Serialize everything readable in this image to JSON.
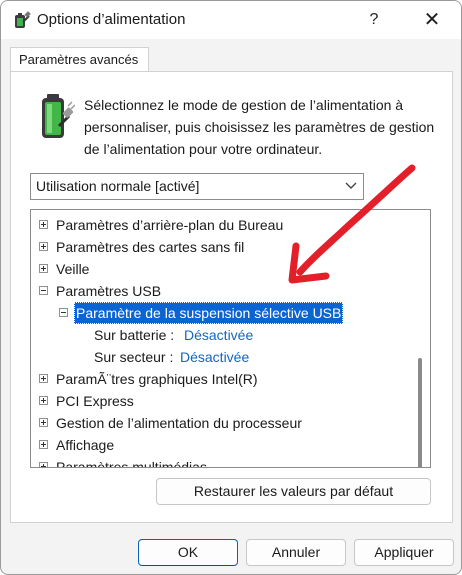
{
  "window": {
    "title": "Options d’alimentation",
    "help": "?",
    "close": "✕"
  },
  "tab": {
    "label": "Paramètres avancés"
  },
  "description": "Sélectionnez le mode de gestion de l’alimentation à personnaliser, puis choisissez les paramètres de gestion de l’alimentation pour votre ordinateur.",
  "plan_select": {
    "value": "Utilisation normale [activé]"
  },
  "tree": {
    "items": [
      {
        "label": "Paramètres d’arrière-plan du Bureau"
      },
      {
        "label": "Paramètres des cartes sans fil"
      },
      {
        "label": "Veille"
      },
      {
        "label": "Paramètres USB"
      },
      {
        "label": "Paramètre de la suspension sélective USB"
      },
      {
        "label": "Sur batterie :",
        "value": "Désactivée"
      },
      {
        "label": "Sur secteur :",
        "value": "Désactivée"
      },
      {
        "label": "ParamÃ¨tres graphiques Intel(R)"
      },
      {
        "label": "PCI Express"
      },
      {
        "label": "Gestion de l’alimentation du processeur"
      },
      {
        "label": "Affichage"
      },
      {
        "label": "Paramètres multimédias"
      }
    ]
  },
  "buttons": {
    "restore": "Restaurer les valeurs par défaut",
    "ok": "OK",
    "cancel": "Annuler",
    "apply": "Appliquer"
  },
  "colors": {
    "selection": "#0a64d2",
    "link_value": "#1565c0",
    "annotation_arrow": "#e3202a"
  }
}
